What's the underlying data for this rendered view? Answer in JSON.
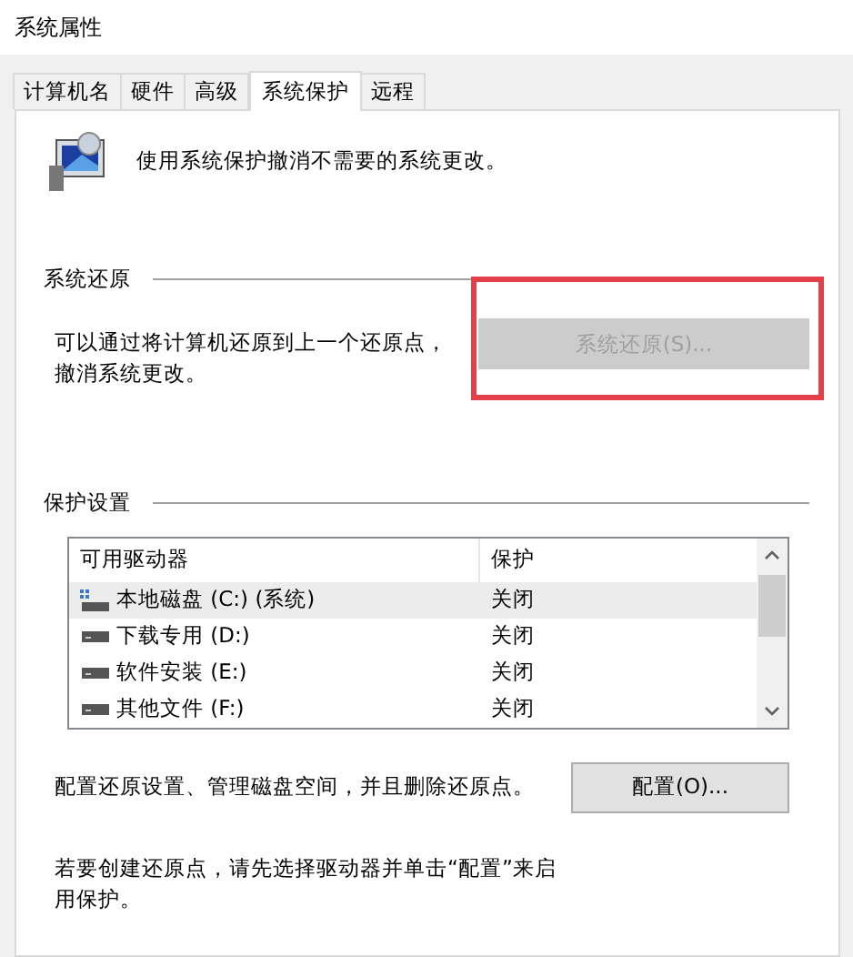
{
  "window": {
    "title": "系统属性"
  },
  "tabs": [
    {
      "label": "计算机名",
      "selected": false
    },
    {
      "label": "硬件",
      "selected": false
    },
    {
      "label": "高级",
      "selected": false
    },
    {
      "label": "系统保护",
      "selected": true
    },
    {
      "label": "远程",
      "selected": false
    }
  ],
  "intro": "使用系统保护撤消不需要的系统更改。",
  "restore": {
    "heading": "系统还原",
    "description": "可以通过将计算机还原到上一个还原点，撤消系统更改。",
    "button": {
      "label": "系统还原(S)...",
      "disabled": true,
      "highlighted": true
    }
  },
  "protection": {
    "heading": "保护设置",
    "columns": [
      "可用驱动器",
      "保护"
    ],
    "rows": [
      {
        "drive": "本地磁盘 (C:) (系统)",
        "protection": "关闭",
        "kind": "system",
        "selected": true
      },
      {
        "drive": "下载专用 (D:)",
        "protection": "关闭",
        "kind": "disk",
        "selected": false
      },
      {
        "drive": "软件安装 (E:)",
        "protection": "关闭",
        "kind": "disk",
        "selected": false
      },
      {
        "drive": "其他文件 (F:)",
        "protection": "关闭",
        "kind": "disk",
        "selected": false
      }
    ],
    "configure_text": "配置还原设置、管理磁盘空间，并且删除还原点。",
    "configure_button": "配置(O)...",
    "create_text": "若要创建还原点，请先选择驱动器并单击“配置”来启用保护。"
  }
}
